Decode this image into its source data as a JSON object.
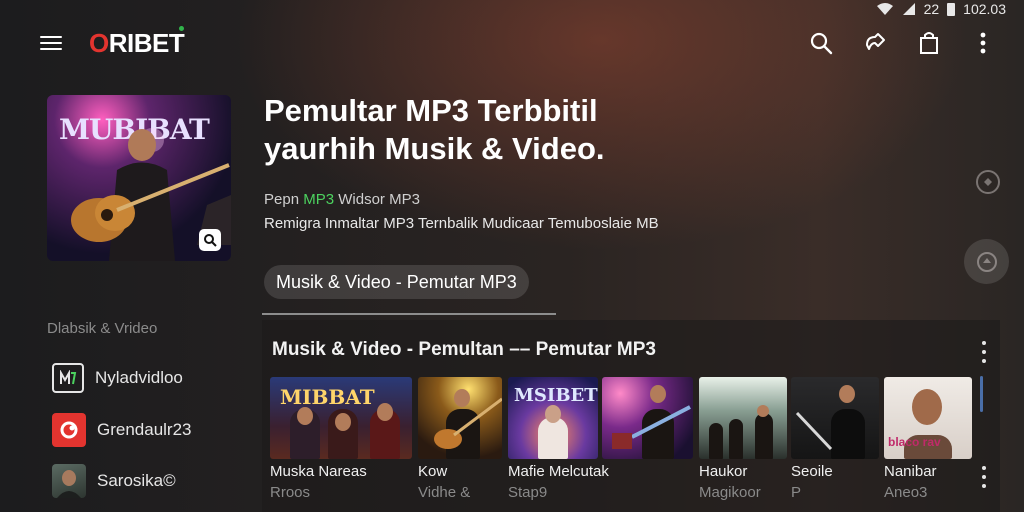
{
  "status_bar": {
    "signal_text": "22",
    "time": "102.03"
  },
  "header": {
    "logo_prefix": "O",
    "logo_rest": "RIBET",
    "icons": [
      "search-icon",
      "share-icon",
      "bag-icon",
      "more-vert-icon"
    ]
  },
  "hero": {
    "art_title": "MUBIBAT",
    "title_line1": "Pemultar MP3 Terbbitil",
    "title_line2": "yaurhih Musik & Video.",
    "meta_prefix": "Pepn",
    "meta_accent": "MP3",
    "meta_suffix": "Widsor MP3",
    "description": "Remigra Inmaltar MP3 Ternbalik Mudicaar Temuboslaie MB",
    "chip_label": "Musik & Video - Pemutar MP3"
  },
  "sidebar": {
    "heading": "Dlabsik & Vrideo",
    "items": [
      {
        "label": "Nyladvidloo",
        "icon": "video-library-icon"
      },
      {
        "label": "Grendaulr23",
        "icon": "red-app-icon"
      },
      {
        "label": "Sarosika©",
        "icon": "profile-avatar-icon"
      }
    ]
  },
  "panel": {
    "title": "Musik & Video - Pemultan –– Pemutar MP3",
    "cards": [
      {
        "title": "Muska Nareas",
        "subtitle": "Rroos",
        "thumb_text": "MIBBAT"
      },
      {
        "title": "Kow",
        "subtitle": "Vidhe &",
        "thumb_text": ""
      },
      {
        "title": "Mafie Melcutak",
        "subtitle": "Stap9",
        "thumb_text": "MSIBET"
      },
      {
        "title": "",
        "subtitle": "",
        "thumb_text": ""
      },
      {
        "title": "Haukor",
        "subtitle": "Magikoor",
        "thumb_text": ""
      },
      {
        "title": "Seoile",
        "subtitle": "P",
        "thumb_text": ""
      },
      {
        "title": "Nanibar",
        "subtitle": "Aneo3",
        "thumb_text": "blaco rav"
      }
    ]
  },
  "colors": {
    "brand_red": "#e3342f",
    "accent_green": "#4cd25f",
    "scroll_blue": "#4a6ea8"
  }
}
